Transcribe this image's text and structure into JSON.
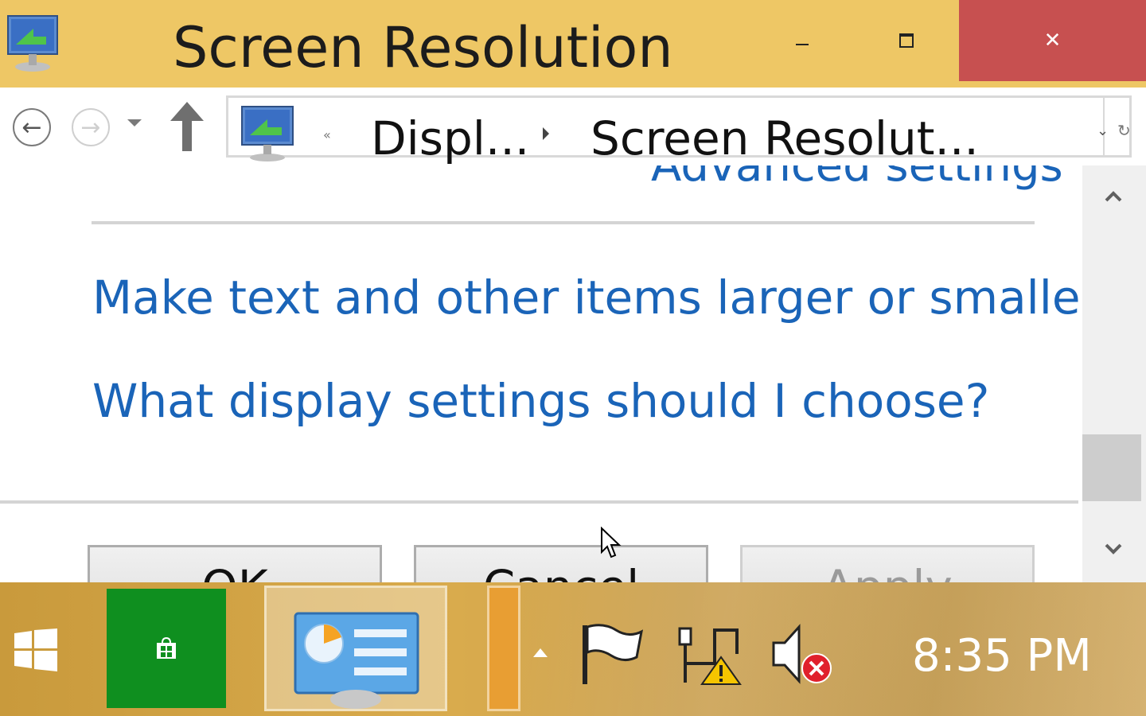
{
  "window": {
    "title": "Screen Resolution",
    "minimize_glyph": "",
    "close_glyph": "✕"
  },
  "navigation": {
    "back_glyph": "←",
    "forward_glyph": "→"
  },
  "address_bar": {
    "overflow_chevron": "«",
    "segment_1": "Displ...",
    "segment_2": "Screen Resolut...",
    "dropdown_glyph": "⌄",
    "refresh_glyph": "↻"
  },
  "content": {
    "advanced_link": "Advanced settings",
    "link_text_size": "Make text and other items larger or smaller",
    "link_help": "What display settings should I choose?"
  },
  "buttons": {
    "ok": "OK",
    "cancel": "Cancel",
    "apply": "Apply"
  },
  "taskbar": {
    "clock": "8:35 PM",
    "store_color": "#0f8f1f",
    "accent_color": "#eec765"
  },
  "colors": {
    "link": "#1a64b8",
    "close_button": "#c75050"
  }
}
